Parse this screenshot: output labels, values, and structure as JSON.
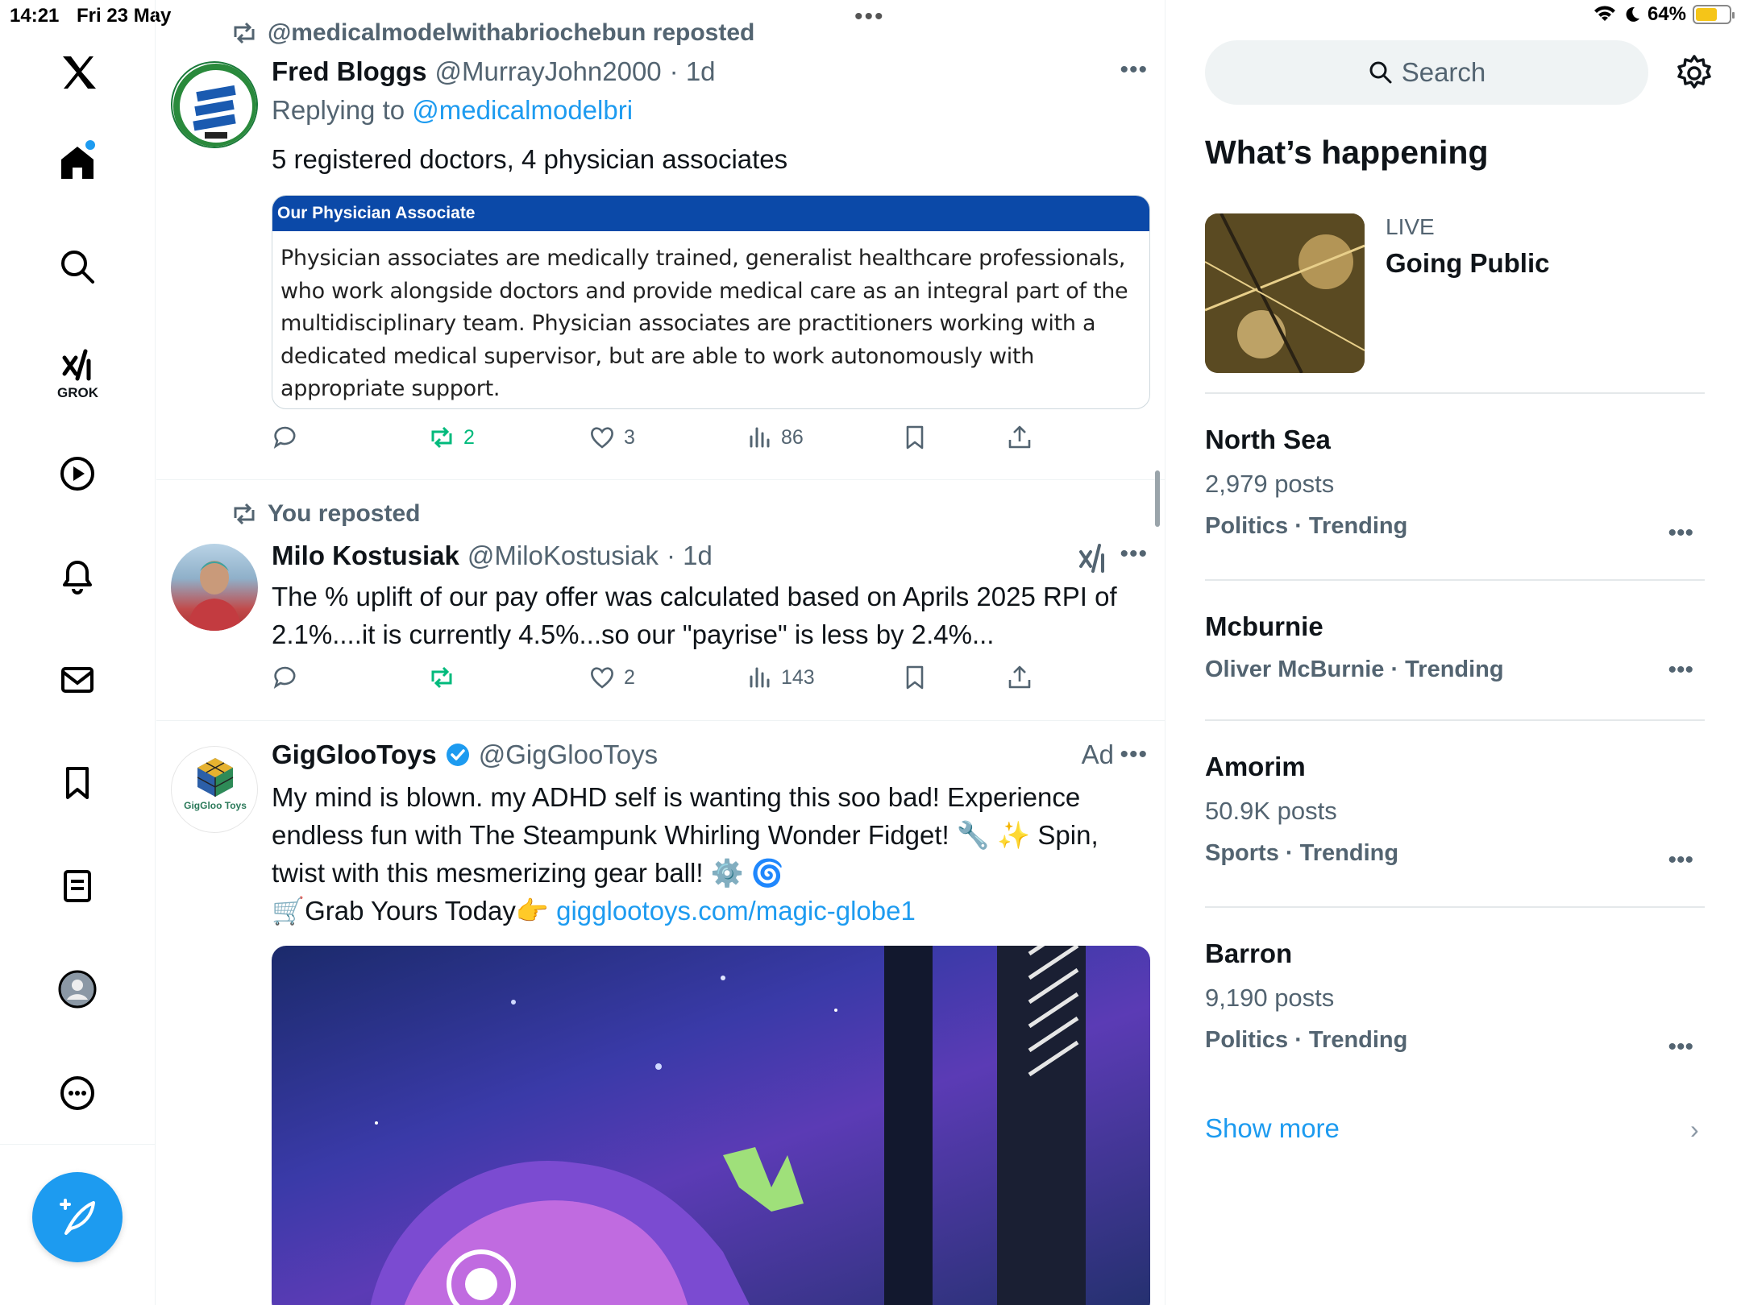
{
  "status_bar": {
    "time": "14:21",
    "date": "Fri 23 May",
    "battery": "64%"
  },
  "nav": {
    "grok_label": "GROK"
  },
  "tweets": [
    {
      "repost_by": "@medicalmodelwithabriochebun reposted",
      "name": "Fred Bloggs",
      "handle": "@MurrayJohn2000",
      "time": "· 1d",
      "replying_prefix": "Replying to ",
      "replying_to": "@medicalmodelbri",
      "text": "5 registered doctors, 4 physician associates",
      "quote_title": "Our Physician Associate",
      "quote_body": "Physician associates are medically trained, generalist healthcare professionals, who work alongside doctors and provide medical care as an integral part of the multidisciplinary team. Physician associates are practitioners working with a dedicated medical supervisor, but are able to work autonomously with appropriate support.",
      "retweets": "2",
      "likes": "3",
      "views": "86"
    },
    {
      "repost_by": "You reposted",
      "name": "Milo Kostusiak",
      "handle": "@MiloKostusiak",
      "time": "· 1d",
      "text": "The % uplift of our pay offer was calculated based on Aprils 2025 RPI of 2.1%....it is currently 4.5%...so our \"payrise\" is less by 2.4%...",
      "retweets": "",
      "likes": "2",
      "views": "143"
    },
    {
      "name": "GigGlooToys",
      "handle": "@GigGlooToys",
      "ad_label": "Ad",
      "text_1": "My mind is blown. my ADHD self is wanting this soo bad! Experience endless fun with The Steampunk Whirling Wonder Fidget! 🔧 ✨ Spin, twist with this mesmerizing gear ball! ⚙️ 🌀",
      "text_2_prefix": "🛒Grab Yours Today👉 ",
      "link": "gigglootoys.com/magic-globe1",
      "avatar_text": "GigGloo Toys"
    }
  ],
  "sidebar": {
    "search_placeholder": "Search",
    "section_title": "What’s happening",
    "live": {
      "label": "LIVE",
      "title": "Going Public"
    },
    "trends": [
      {
        "name": "North Sea",
        "posts": "2,979 posts",
        "category": "Politics · Trending"
      },
      {
        "name": "Mcburnie",
        "posts": "",
        "category": "Oliver McBurnie · Trending"
      },
      {
        "name": "Amorim",
        "posts": "50.9K posts",
        "category": "Sports · Trending"
      },
      {
        "name": "Barron",
        "posts": "9,190 posts",
        "category": "Politics · Trending"
      }
    ],
    "show_more": "Show more"
  },
  "colors": {
    "accent": "#1d9bf0",
    "retweet_green": "#00ba7c",
    "muted": "#536471"
  }
}
